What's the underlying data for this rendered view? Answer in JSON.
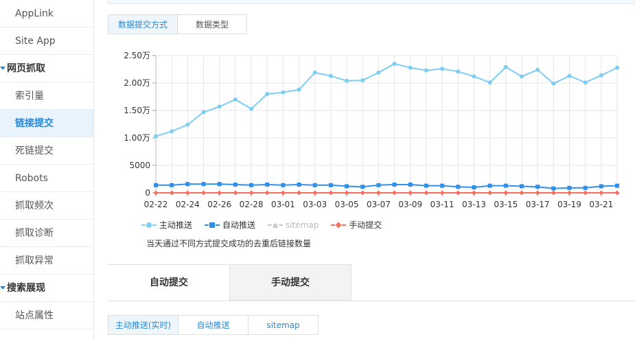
{
  "sidebar": {
    "items": [
      {
        "label": "AppLink",
        "type": "item"
      },
      {
        "label": "Site App",
        "type": "item"
      },
      {
        "label": "网页抓取",
        "type": "section"
      },
      {
        "label": "索引量",
        "type": "item"
      },
      {
        "label": "链接提交",
        "type": "item",
        "active": true
      },
      {
        "label": "死链提交",
        "type": "item"
      },
      {
        "label": "Robots",
        "type": "item"
      },
      {
        "label": "抓取频次",
        "type": "item"
      },
      {
        "label": "抓取诊断",
        "type": "item"
      },
      {
        "label": "抓取异常",
        "type": "item"
      },
      {
        "label": "搜索展现",
        "type": "section"
      },
      {
        "label": "站点属性",
        "type": "item"
      }
    ]
  },
  "top_tabs": [
    {
      "label": "数据提交方式",
      "active": true
    },
    {
      "label": "数据类型",
      "active": false
    }
  ],
  "chart_data": {
    "type": "line",
    "x": [
      "02-22",
      "02-23",
      "02-24",
      "02-25",
      "02-26",
      "02-27",
      "02-28",
      "02-29",
      "03-01",
      "03-02",
      "03-03",
      "03-04",
      "03-05",
      "03-06",
      "03-07",
      "03-08",
      "03-09",
      "03-10",
      "03-11",
      "03-12",
      "03-13",
      "03-14",
      "03-15",
      "03-16",
      "03-17",
      "03-18",
      "03-19",
      "03-20",
      "03-21",
      "03-22"
    ],
    "x_tick_labels": [
      "02-22",
      "02-24",
      "02-26",
      "02-28",
      "03-01",
      "03-03",
      "03-05",
      "03-07",
      "03-09",
      "03-11",
      "03-13",
      "03-15",
      "03-17",
      "03-19",
      "03-21"
    ],
    "y_tick_labels": [
      "0",
      "5000",
      "1.00万",
      "1.50万",
      "2.00万",
      "2.50万"
    ],
    "ylim": [
      0,
      25000
    ],
    "grid": true,
    "legend": "bottom",
    "series": [
      {
        "name": "主动推送",
        "color": "#7dcdf3",
        "marker": "circle",
        "visible": true,
        "values": [
          10300,
          11200,
          12400,
          14700,
          15700,
          17000,
          15300,
          18000,
          18300,
          18800,
          21900,
          21300,
          20400,
          20500,
          21900,
          23500,
          22800,
          22300,
          22600,
          22100,
          21200,
          20100,
          22900,
          21200,
          22400,
          19900,
          21300,
          20100,
          21400,
          22800
        ]
      },
      {
        "name": "自动推送",
        "color": "#2f8fe9",
        "marker": "square",
        "visible": true,
        "values": [
          1400,
          1400,
          1600,
          1600,
          1600,
          1500,
          1400,
          1500,
          1400,
          1500,
          1400,
          1400,
          1200,
          1100,
          1400,
          1500,
          1500,
          1300,
          1300,
          1100,
          1000,
          1300,
          1300,
          1200,
          1100,
          800,
          900,
          900,
          1200,
          1300
        ]
      },
      {
        "name": "sitemap",
        "color": "#c8c8c8",
        "marker": "triangle",
        "visible": false,
        "values": []
      },
      {
        "name": "手动提交",
        "color": "#f36e5d",
        "marker": "diamond",
        "visible": true,
        "values": [
          0,
          0,
          0,
          0,
          0,
          0,
          0,
          0,
          0,
          0,
          0,
          0,
          0,
          0,
          0,
          0,
          0,
          0,
          0,
          0,
          0,
          0,
          0,
          0,
          0,
          0,
          0,
          0,
          0,
          0
        ]
      }
    ]
  },
  "chart_note": "当天通过不同方式提交成功的去重后链接数量",
  "bottom_tabs": [
    {
      "label": "自动提交",
      "active": true
    },
    {
      "label": "手动提交",
      "active": false
    }
  ],
  "sub_tabs": [
    {
      "label": "主动推送(实时)",
      "active": true
    },
    {
      "label": "自动推送",
      "active": false
    },
    {
      "label": "sitemap",
      "active": false
    }
  ]
}
